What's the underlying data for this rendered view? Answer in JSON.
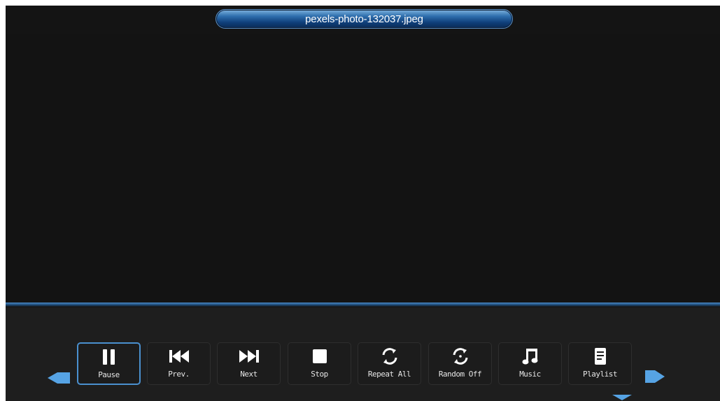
{
  "title": {
    "filename": "pexels-photo-132037.jpeg"
  },
  "controls": [
    {
      "label": "Pause",
      "icon": "pause-icon",
      "selected": true
    },
    {
      "label": "Prev.",
      "icon": "previous-icon",
      "selected": false
    },
    {
      "label": "Next",
      "icon": "next-icon",
      "selected": false
    },
    {
      "label": "Stop",
      "icon": "stop-icon",
      "selected": false
    },
    {
      "label": "Repeat All",
      "icon": "repeat-icon",
      "selected": false
    },
    {
      "label": "Random Off",
      "icon": "random-icon",
      "selected": false
    },
    {
      "label": "Music",
      "icon": "music-note-icon",
      "selected": false
    },
    {
      "label": "Playlist",
      "icon": "playlist-icon",
      "selected": false
    }
  ],
  "nav": {
    "left": "arrow-left-icon",
    "right": "arrow-right-icon",
    "down": "arrow-down-icon"
  },
  "colors": {
    "accent": "#4a90cf",
    "background": "#141414",
    "bar": "#1e1e1e"
  }
}
